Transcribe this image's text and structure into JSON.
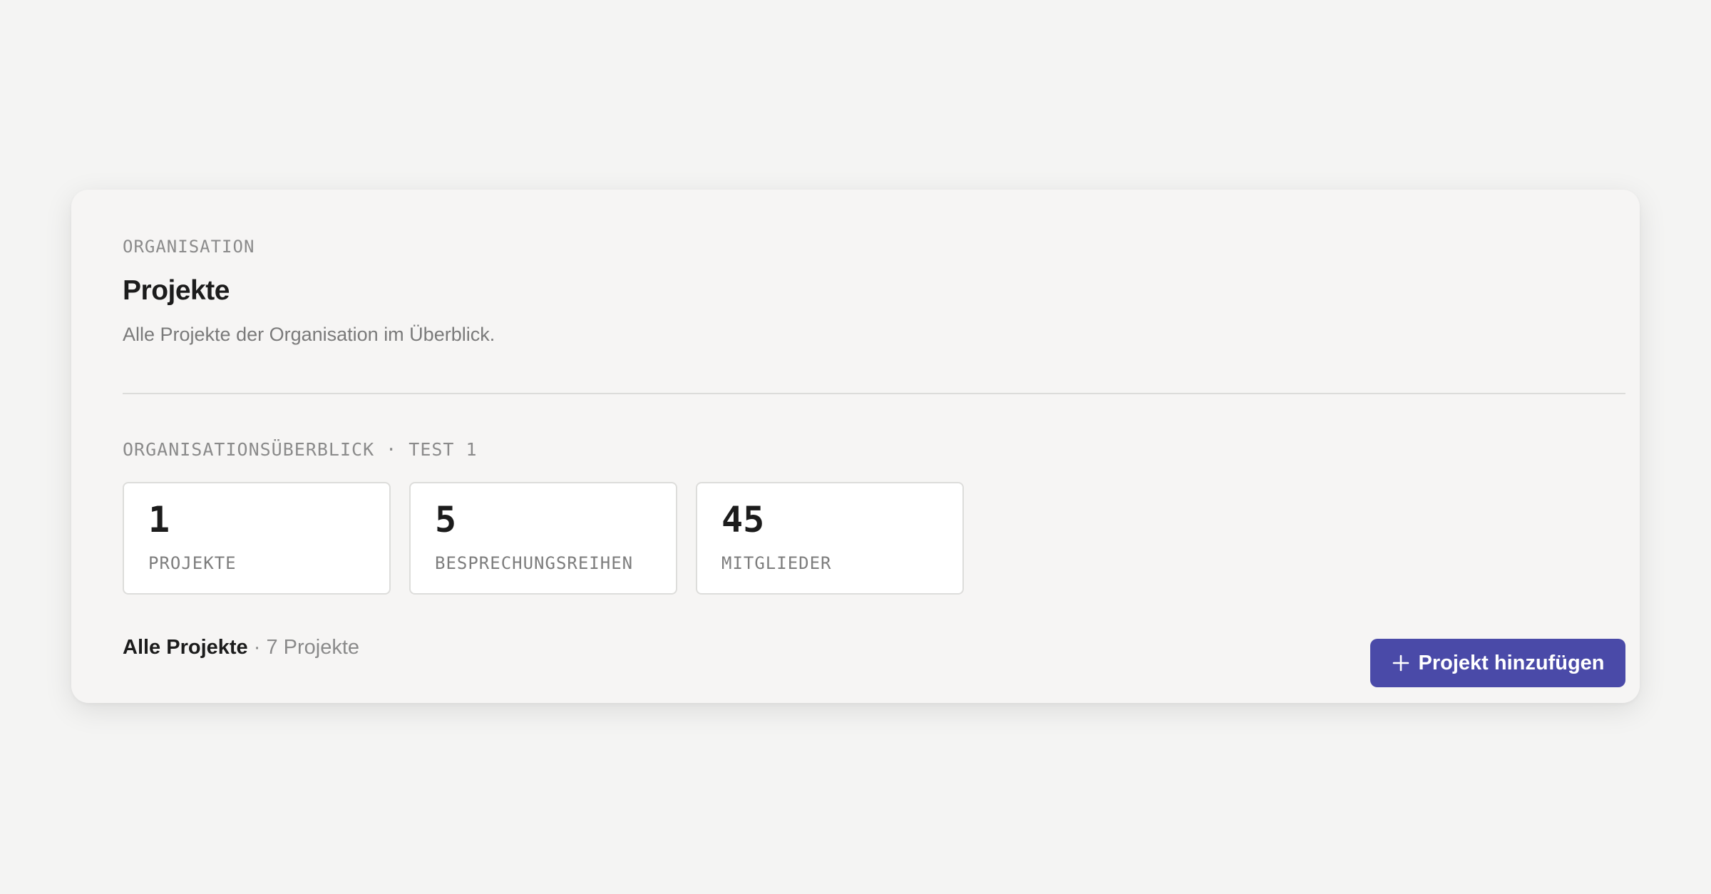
{
  "header": {
    "eyebrow": "ORGANISATION",
    "title": "Projekte",
    "subtitle": "Alle Projekte der Organisation im Überblick."
  },
  "overview": {
    "label": "ORGANISATIONSÜBERBLICK · TEST 1",
    "stats": [
      {
        "value": "1",
        "label": "PROJEKTE"
      },
      {
        "value": "5",
        "label": "BESPRECHUNGSREIHEN"
      },
      {
        "value": "45",
        "label": "MITGLIEDER"
      }
    ]
  },
  "projects": {
    "title": "Alle Projekte",
    "separator": "·",
    "count_text": "7 Projekte",
    "add_button_label": "Projekt hinzufügen",
    "add_button_icon": "plus-icon"
  },
  "colors": {
    "background": "#f4f4f3",
    "card": "#f6f5f4",
    "accent": "#4a4aa8",
    "muted_text": "#8b8b8b"
  }
}
